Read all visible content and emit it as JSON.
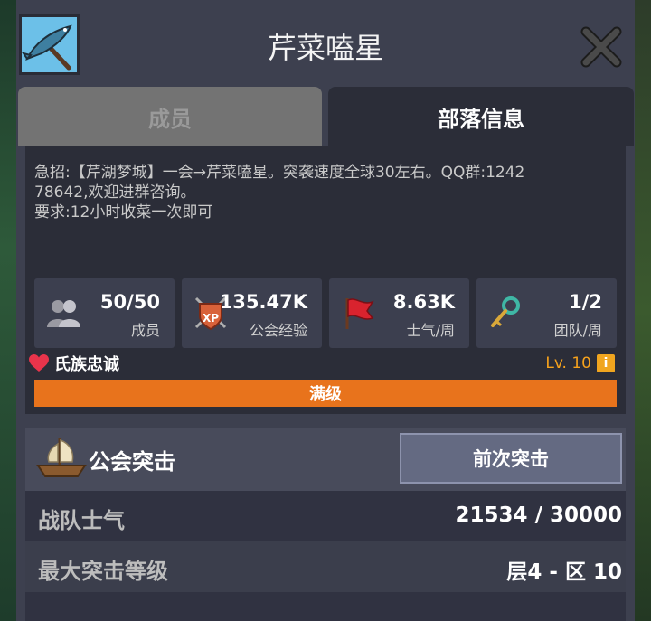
{
  "header": {
    "title": "芹菜嗑星",
    "emblem_icon": "fish-pickaxe-icon",
    "close_icon": "close-icon"
  },
  "tabs": [
    {
      "label": "成员",
      "active": false
    },
    {
      "label": "部落信息",
      "active": true
    }
  ],
  "description": "急招:【芹湖梦城】一会→芹菜嗑星。突袭速度全球30左右。QQ群:1242\n78642,欢迎进群咨询。\n要求:12小时收菜一次即可",
  "stats": [
    {
      "icon": "members-icon",
      "value": "50/50",
      "label": "成员"
    },
    {
      "icon": "xp-shield-icon",
      "value": "135.47K",
      "label": "公会经验"
    },
    {
      "icon": "red-flag-icon",
      "value": "8.63K",
      "label": "士气/周"
    },
    {
      "icon": "key-icon",
      "value": "1/2",
      "label": "团队/周"
    }
  ],
  "loyalty": {
    "icon": "heart-icon",
    "label": "氏族忠诚",
    "level": "Lv. 10",
    "info_icon": "info-icon",
    "bar_fraction": 1.0,
    "bar_label": "满级"
  },
  "raid": {
    "icon": "ship-icon",
    "title": "公会突击",
    "button_label": "前次突击",
    "rows": [
      {
        "label": "战队士气",
        "value": "21534 / 30000"
      },
      {
        "label": "最大突击等级",
        "value": "层4 - 区 10"
      }
    ]
  },
  "colors": {
    "accent_orange": "#e8731c",
    "level_orange": "#f6a21c",
    "panel_bg": "#3d404f",
    "dark_bg": "#2b2d38"
  }
}
